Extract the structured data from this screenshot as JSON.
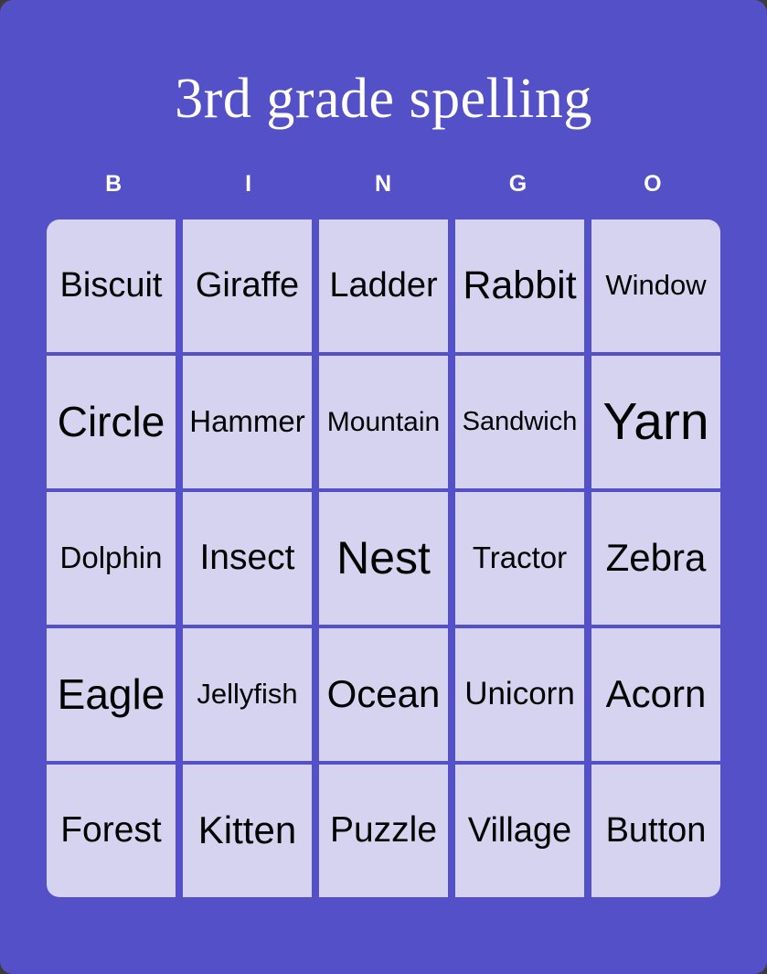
{
  "card": {
    "title": "3rd grade spelling",
    "background_color": "#5450c8",
    "cell_color": "#d5d3f0",
    "title_color": "#ffffff",
    "text_color": "#000000"
  },
  "header": {
    "letters": [
      "B",
      "I",
      "N",
      "G",
      "O"
    ]
  },
  "grid": {
    "columns": 5,
    "rows": 5,
    "cells": [
      {
        "label": "Biscuit",
        "font_size": 38
      },
      {
        "label": "Giraffe",
        "font_size": 38
      },
      {
        "label": "Ladder",
        "font_size": 38
      },
      {
        "label": "Rabbit",
        "font_size": 43
      },
      {
        "label": "Window",
        "font_size": 31
      },
      {
        "label": "Circle",
        "font_size": 46
      },
      {
        "label": "Hammer",
        "font_size": 33
      },
      {
        "label": "Mountain",
        "font_size": 30
      },
      {
        "label": "Sandwich",
        "font_size": 29
      },
      {
        "label": "Yarn",
        "font_size": 57
      },
      {
        "label": "Dolphin",
        "font_size": 33
      },
      {
        "label": "Insect",
        "font_size": 39
      },
      {
        "label": "Nest",
        "font_size": 50
      },
      {
        "label": "Tractor",
        "font_size": 33
      },
      {
        "label": "Zebra",
        "font_size": 42
      },
      {
        "label": "Eagle",
        "font_size": 46
      },
      {
        "label": "Jellyfish",
        "font_size": 31
      },
      {
        "label": "Ocean",
        "font_size": 42
      },
      {
        "label": "Unicorn",
        "font_size": 35
      },
      {
        "label": "Acorn",
        "font_size": 42
      },
      {
        "label": "Forest",
        "font_size": 39
      },
      {
        "label": "Kitten",
        "font_size": 42
      },
      {
        "label": "Puzzle",
        "font_size": 39
      },
      {
        "label": "Village",
        "font_size": 38
      },
      {
        "label": "Button",
        "font_size": 38
      }
    ]
  }
}
